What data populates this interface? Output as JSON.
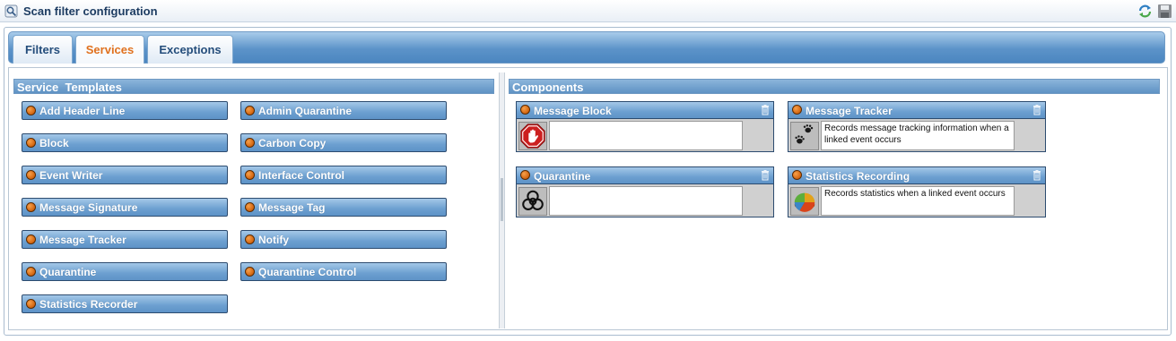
{
  "window": {
    "title": "Scan filter configuration"
  },
  "tabs": [
    {
      "label": "Filters",
      "active": false
    },
    {
      "label": "Services",
      "active": true
    },
    {
      "label": "Exceptions",
      "active": false
    }
  ],
  "service_templates": {
    "header": "Service  Templates",
    "items": [
      "Add Header Line",
      "Admin Quarantine",
      "Block",
      "Carbon Copy",
      "Event Writer",
      "Interface Control",
      "Message Signature",
      "Message Tag",
      "Message Tracker",
      "Notify",
      "Quarantine",
      "Quarantine Control",
      "Statistics Recorder"
    ]
  },
  "components": {
    "header": "Components",
    "items": [
      {
        "title": "Message Block",
        "icon": "stop-hand-icon",
        "description": ""
      },
      {
        "title": "Message Tracker",
        "icon": "paw-prints-icon",
        "description": "Records message tracking information when a linked event occurs"
      },
      {
        "title": "Quarantine",
        "icon": "biohazard-icon",
        "description": ""
      },
      {
        "title": "Statistics Recording",
        "icon": "pie-chart-icon",
        "description": "Records statistics when a linked event occurs"
      }
    ]
  },
  "colors": {
    "accent_tab": "#e0711e",
    "header_blue": "#5e92c4",
    "status_dot": "#d2640f"
  }
}
